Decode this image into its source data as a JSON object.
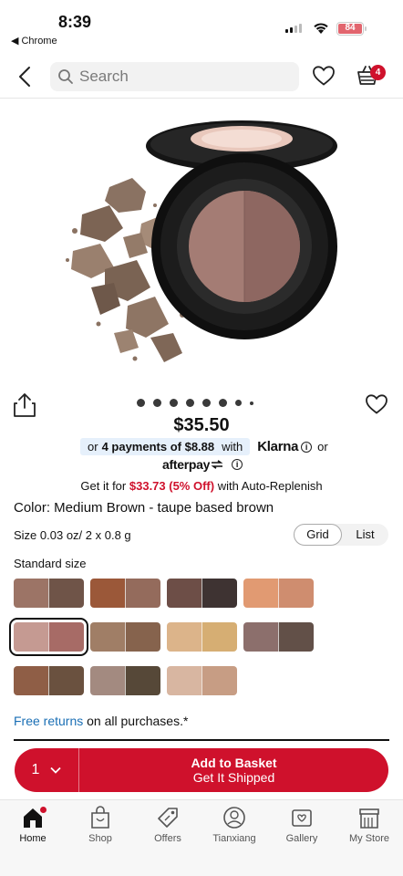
{
  "status_bar": {
    "time": "8:39",
    "back_app": "Chrome",
    "battery": "84"
  },
  "header": {
    "search_placeholder": "Search",
    "basket_count": "4"
  },
  "product": {
    "price": "$35.50",
    "klarna": {
      "prefix": "or",
      "payments": "4 payments of $8.88",
      "with": "with",
      "brand": "Klarna",
      "or": "or"
    },
    "afterpay": {
      "brand": "afterpay"
    },
    "auto_replenish": {
      "prefix": "Get it for",
      "price": "$33.73 (5% Off)",
      "suffix": "with Auto-Replenish"
    },
    "color_line": "Color: Medium Brown - taupe based brown",
    "size_line": "Size 0.03 oz/ 2 x 0.8 g",
    "view_toggle": {
      "grid": "Grid",
      "list": "List",
      "active": "Grid"
    },
    "size_option": "Standard size",
    "carousel": {
      "count": 8,
      "active": 1
    }
  },
  "swatches": [
    {
      "colors": [
        "#9c7466",
        "#6f5448"
      ]
    },
    {
      "colors": [
        "#9b5839",
        "#946b5c"
      ]
    },
    {
      "colors": [
        "#6d4e47",
        "#3e3332"
      ]
    },
    {
      "colors": [
        "#e19a72",
        "#cf8d6f"
      ]
    },
    {
      "colors": [
        "#c59a92",
        "#a76b66"
      ],
      "selected": true
    },
    {
      "colors": [
        "#a07e66",
        "#86634d"
      ]
    },
    {
      "colors": [
        "#dcb48a",
        "#d6ae73"
      ]
    },
    {
      "colors": [
        "#8c6f6c",
        "#625048"
      ]
    },
    {
      "colors": [
        "#8f5e46",
        "#6a513f"
      ]
    },
    {
      "colors": [
        "#a38a80",
        "#564838"
      ]
    },
    {
      "colors": [
        "#d8b6a1",
        "#c79d84"
      ]
    }
  ],
  "returns": {
    "link": "Free returns",
    "text": "on all purchases.*"
  },
  "add_to_basket": {
    "qty": "1",
    "line1": "Add to Basket",
    "line2": "Get It Shipped"
  },
  "tabs": [
    {
      "label": "Home",
      "icon": "home-icon",
      "active": true
    },
    {
      "label": "Shop",
      "icon": "shop-bag-icon"
    },
    {
      "label": "Offers",
      "icon": "offers-tag-icon"
    },
    {
      "label": "Tianxiang",
      "icon": "profile-icon"
    },
    {
      "label": "Gallery",
      "icon": "gallery-icon"
    },
    {
      "label": "My Store",
      "icon": "store-icon"
    }
  ],
  "colors": {
    "brand_red": "#cf112c",
    "link_blue": "#1a6fb5",
    "klarna_bg": "#e6f0fb"
  }
}
